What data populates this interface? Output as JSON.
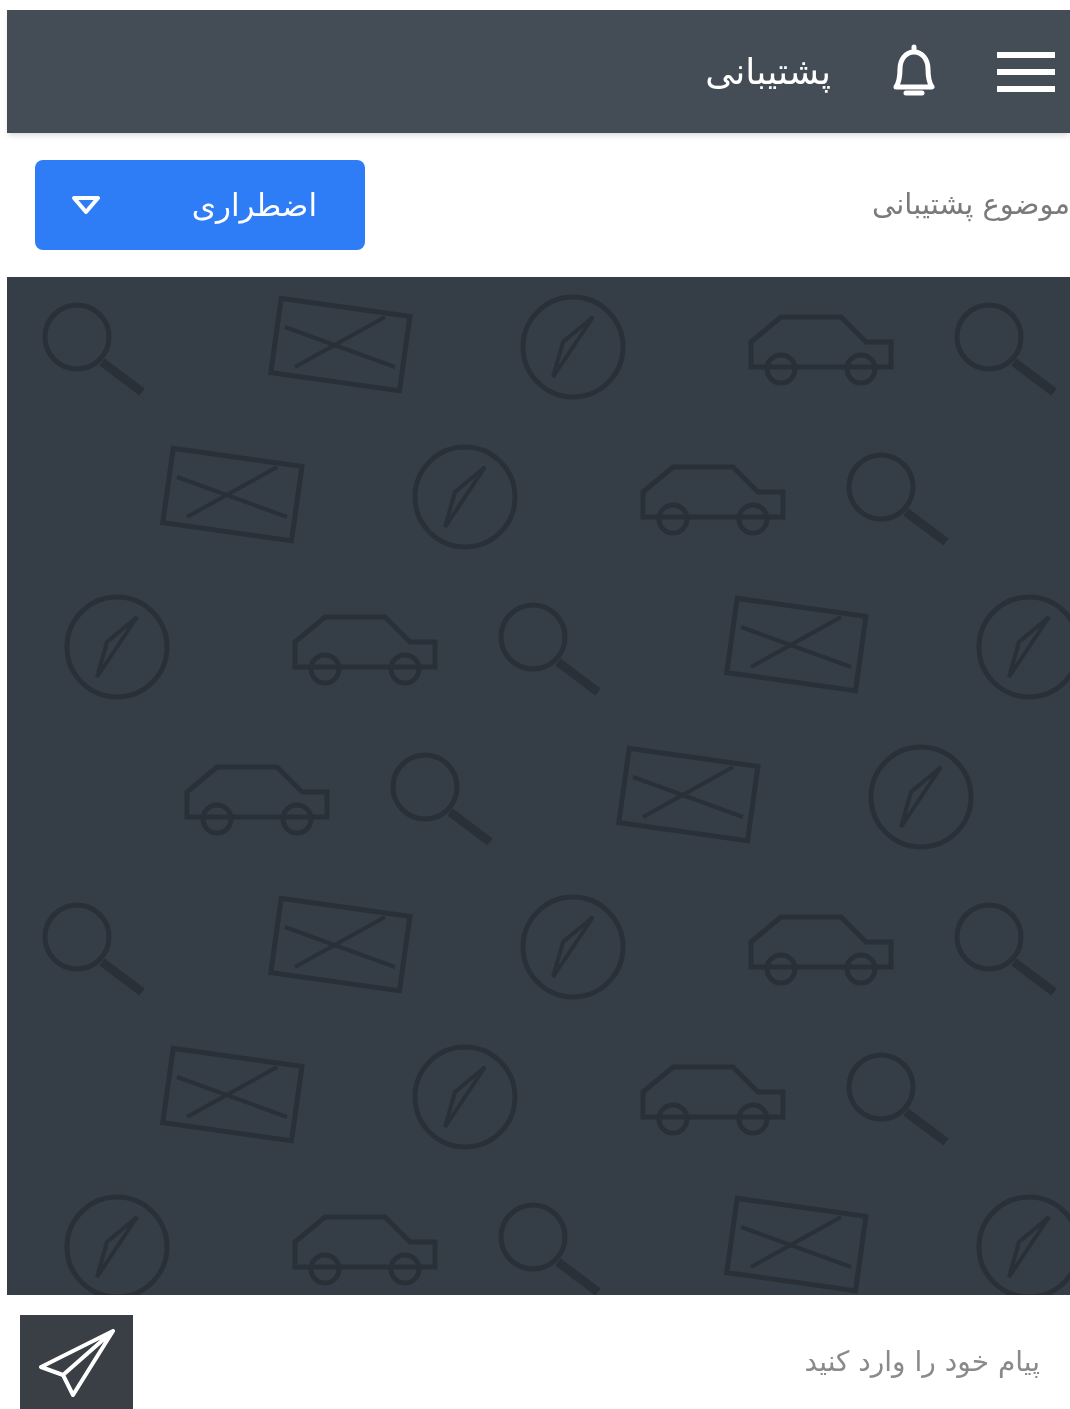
{
  "header": {
    "title": "پشتیبانی"
  },
  "subject": {
    "label": "موضوع پشتیبانی",
    "dropdown": {
      "value": "اضطراری"
    }
  },
  "composer": {
    "placeholder": "پیام خود را وارد کنید"
  }
}
